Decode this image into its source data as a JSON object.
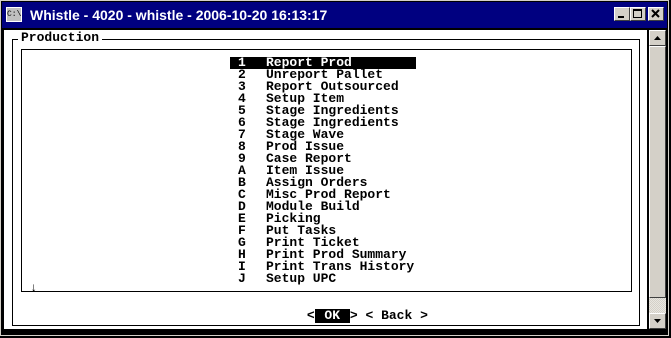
{
  "window": {
    "icon_label": "C:\\",
    "title": "Whistle - 4020 - whistle - 2006-10-20 16:13:17",
    "colors": {
      "titlebar": "#000080",
      "console_bg": "#ffffff",
      "selection_bg": "#000000"
    }
  },
  "screen": {
    "frame_title": "Production",
    "scroll_indicator": "↓",
    "menu": [
      {
        "key": "1",
        "label": "Report Prod",
        "selected": true
      },
      {
        "key": "2",
        "label": "Unreport Pallet"
      },
      {
        "key": "3",
        "label": "Report Outsourced"
      },
      {
        "key": "4",
        "label": "Setup Item"
      },
      {
        "key": "5",
        "label": "Stage Ingredients"
      },
      {
        "key": "6",
        "label": "Stage Ingredients"
      },
      {
        "key": "7",
        "label": "Stage Wave"
      },
      {
        "key": "8",
        "label": "Prod Issue"
      },
      {
        "key": "9",
        "label": "Case Report"
      },
      {
        "key": "A",
        "label": "Item Issue"
      },
      {
        "key": "B",
        "label": "Assign Orders"
      },
      {
        "key": "C",
        "label": "Misc Prod Report"
      },
      {
        "key": "D",
        "label": "Module Build"
      },
      {
        "key": "E",
        "label": "Picking"
      },
      {
        "key": "F",
        "label": "Put Tasks"
      },
      {
        "key": "G",
        "label": "Print Ticket"
      },
      {
        "key": "H",
        "label": "Print Prod Summary"
      },
      {
        "key": "I",
        "label": "Print Trans History"
      },
      {
        "key": "J",
        "label": "Setup UPC"
      }
    ],
    "buttons": {
      "ok_open": "<",
      "ok_label": " OK ",
      "ok_close": ">",
      "back_label": "< Back >"
    }
  }
}
